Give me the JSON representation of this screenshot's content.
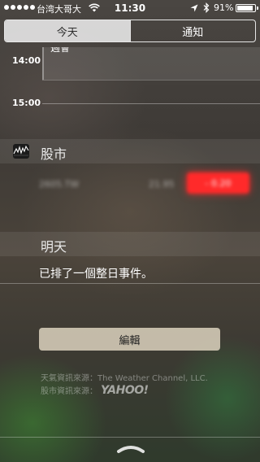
{
  "status_bar": {
    "carrier": "台湾大哥大",
    "time": "11:30",
    "battery_percent_label": "91%",
    "battery_level": 0.91,
    "icons": [
      "signal-dots",
      "wifi-icon",
      "location-icon",
      "bluetooth-icon",
      "battery-icon"
    ]
  },
  "tabs": [
    {
      "label": "今天",
      "selected": true
    },
    {
      "label": "通知",
      "selected": false
    }
  ],
  "calendar": {
    "event_title": "週會",
    "hours": [
      "14:00",
      "15:00"
    ]
  },
  "stocks": {
    "section_title": "股市",
    "row": {
      "symbol": "2605.TW",
      "price": "21.95",
      "change": "- 0.20",
      "change_color": "#ff2a2a"
    }
  },
  "tomorrow": {
    "section_title": "明天",
    "summary": "已排了一個整日事件。"
  },
  "edit_button": {
    "label": "編輯"
  },
  "sources": {
    "weather": "天氣資訊來源：The Weather Channel, LLC.",
    "stocks_label": "股市資訊來源：",
    "stocks_logo": "YAHOO!"
  },
  "colors": {
    "accent_negative": "#ff2a2a",
    "tab_selected_bg": "#ebebeb"
  }
}
